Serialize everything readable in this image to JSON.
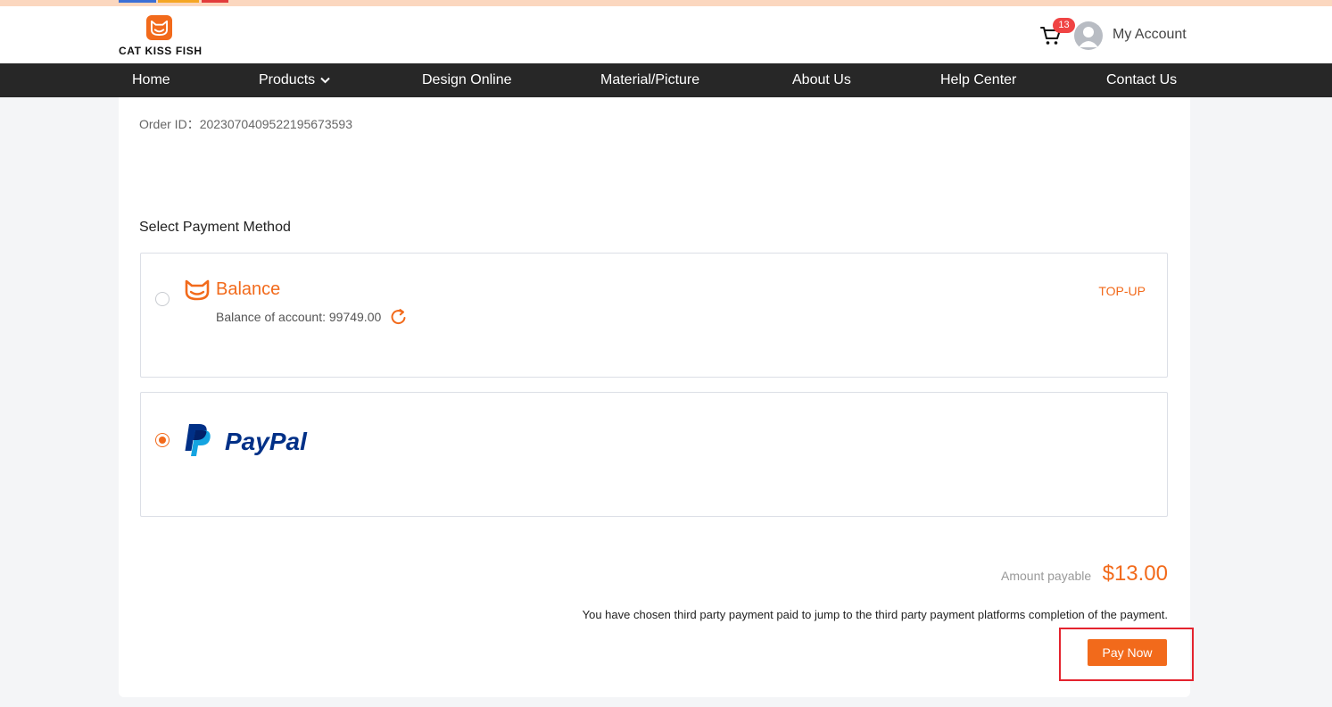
{
  "brand": {
    "name": "CAT KISS FISH",
    "color": "#f26a1b"
  },
  "header": {
    "cart_count": "13",
    "account_label": "My Account"
  },
  "nav": {
    "items": [
      {
        "label": "Home"
      },
      {
        "label": "Products"
      },
      {
        "label": "Design Online"
      },
      {
        "label": "Material/Picture"
      },
      {
        "label": "About Us"
      },
      {
        "label": "Help Center"
      },
      {
        "label": "Contact Us"
      }
    ]
  },
  "order": {
    "id_label": "Order ID：",
    "id_value": "2023070409522195673593"
  },
  "payment": {
    "section_title": "Select Payment Method",
    "balance": {
      "title": "Balance",
      "account_label": "Balance of account: ",
      "account_value": "99749.00",
      "topup_label": "TOP-UP",
      "selected": false
    },
    "paypal": {
      "wordmark": "PayPal",
      "selected": true,
      "colors": {
        "dark": "#003087",
        "light": "#009cde"
      }
    }
  },
  "summary": {
    "amount_label": "Amount payable",
    "amount_value": "$13.00",
    "notice": "You have chosen third party payment paid to jump to the third party payment platforms completion of the payment.",
    "pay_button": "Pay Now"
  },
  "colors": {
    "accent": "#f26a1b",
    "badge": "#f04444",
    "nav_bg": "#272727",
    "highlight": "#e4232e"
  }
}
